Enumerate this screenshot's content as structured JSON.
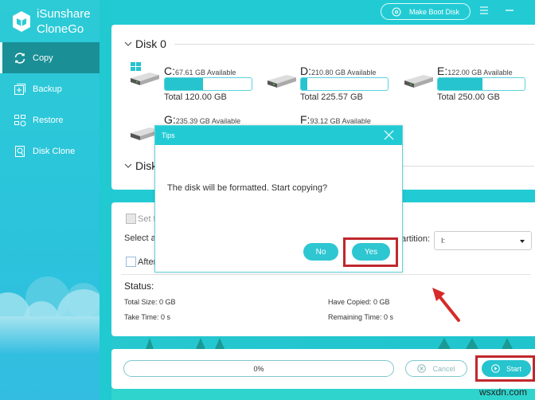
{
  "app": {
    "name_line1": "iSunshare",
    "name_line2": "CloneGo",
    "accent_color": "#22cbd4",
    "highlight_color": "#c0282d"
  },
  "sidebar": {
    "items": [
      {
        "label": "Copy",
        "icon": "copy-sync-icon",
        "active": true
      },
      {
        "label": "Backup",
        "icon": "backup-icon",
        "active": false
      },
      {
        "label": "Restore",
        "icon": "restore-icon",
        "active": false
      },
      {
        "label": "Disk Clone",
        "icon": "disk-clone-icon",
        "active": false
      }
    ]
  },
  "topbar": {
    "make_boot_disk_label": "Make Boot Disk",
    "menu_icon": "hamburger-menu-icon",
    "minimize_icon": "minimize-icon"
  },
  "disks": [
    {
      "name": "Disk 0",
      "partitions": [
        {
          "letter": "C:",
          "available": "67.61 GB Available",
          "total": "Total 120.00 GB",
          "used_fraction": 0.44,
          "os": true
        },
        {
          "letter": "D:",
          "available": "210.80 GB Available",
          "total": "Total 225.57 GB",
          "used_fraction": 0.07,
          "os": false
        },
        {
          "letter": "E:",
          "available": "122.00 GB Available",
          "total": "Total 250.00 GB",
          "used_fraction": 0.51,
          "os": false
        },
        {
          "letter": "G:",
          "available": "235.39 GB Available",
          "os": false
        },
        {
          "letter": "F:",
          "available": "93.12 GB Available",
          "os": false
        }
      ]
    },
    {
      "name": "Disk 1",
      "visible_label": "Disk"
    }
  ],
  "settings": {
    "set_target_label": "Set t",
    "select_label": "Select a",
    "partition_label": "artition:",
    "partition_value": "I:",
    "after_label": "After"
  },
  "status": {
    "title": "Status:",
    "total_size": "Total Size: 0 GB",
    "have_copied": "Have Copied: 0 GB",
    "take_time": "Take Time: 0 s",
    "remaining_time": "Remaining Time: 0 s"
  },
  "bottom": {
    "progress_percent": 0,
    "progress_label": "0%",
    "cancel_label": "Cancel",
    "start_label": "Start"
  },
  "dialog": {
    "title": "Tips",
    "message": "The disk will be formatted. Start copying?",
    "no_label": "No",
    "yes_label": "Yes"
  },
  "watermark": "wsxdn.com"
}
